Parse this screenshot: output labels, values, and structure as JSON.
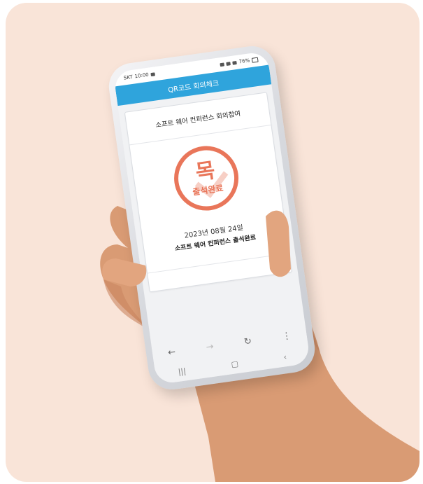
{
  "status_bar": {
    "carrier": "SKT",
    "time": "10:00",
    "battery": "76%"
  },
  "app_bar": {
    "title": "QR코드 회의체크"
  },
  "panel": {
    "title": "소프트 웨어 컨퍼런스 회의참여",
    "stamp_day": "목",
    "stamp_text": "출석완료",
    "date": "2023년 08월 24일",
    "completed": "소프트 웨어 컨퍼런스 출석완료"
  },
  "browser": {
    "back_icon": "←",
    "forward_icon": "→",
    "reload_icon": "↻",
    "menu_icon": "⋮"
  },
  "system_nav": {
    "recents_icon": "|||",
    "home_icon": "▢",
    "back_icon": "‹"
  },
  "colors": {
    "accent": "#2fa4dc",
    "stamp": "#e9765a",
    "background": "#f9e4d8"
  }
}
